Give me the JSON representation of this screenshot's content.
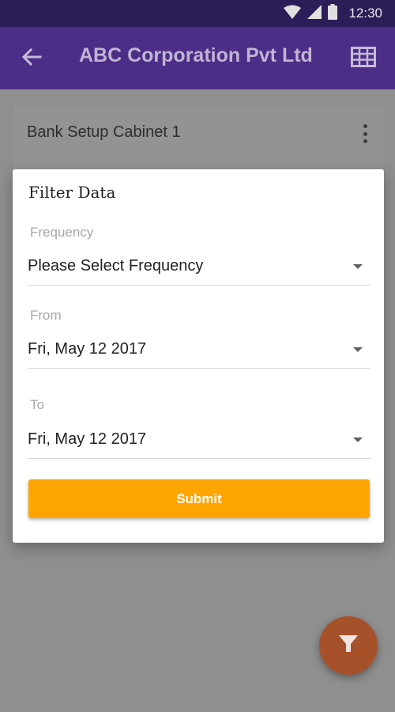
{
  "status_bar": {
    "time": "12:30",
    "icons": [
      "wifi-icon",
      "signal-icon",
      "battery-icon"
    ]
  },
  "app_bar": {
    "title": "ABC Corporation Pvt Ltd",
    "left_icon": "back-arrow-icon",
    "right_icon": "table-grid-icon"
  },
  "card": {
    "title": "Bank Setup Cabinet 1",
    "menu_icon": "more-vertical-icon"
  },
  "dialog": {
    "title": "Filter Data",
    "fields": [
      {
        "label": "Frequency",
        "value": "Please Select Frequency"
      },
      {
        "label": "From",
        "value": "Fri, May 12 2017"
      },
      {
        "label": "To",
        "value": "Fri, May 12 2017"
      }
    ],
    "submit_label": "Submit"
  },
  "fab": {
    "icon": "filter-icon"
  },
  "colors": {
    "status_bar": "#2c1c57",
    "app_bar": "#4c2d87",
    "accent": "#ffa500",
    "fab": "#a7512b",
    "scrim": "#8f8f8f"
  }
}
